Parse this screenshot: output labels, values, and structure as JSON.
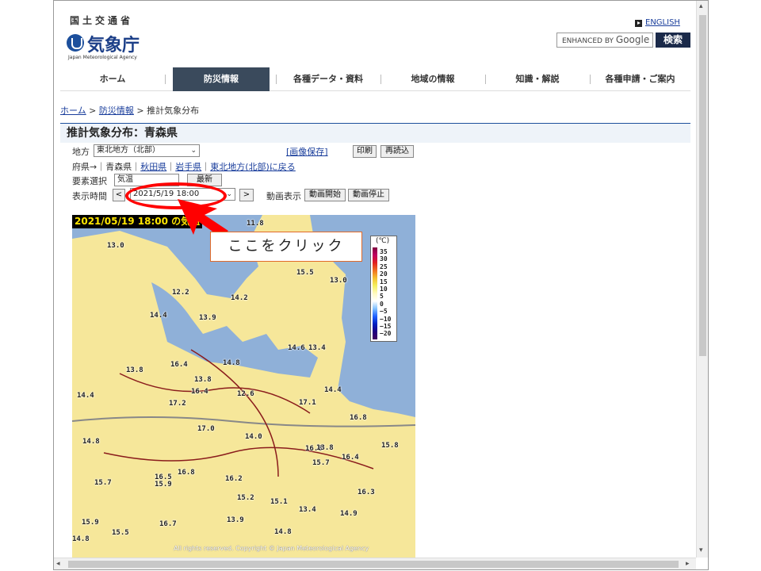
{
  "header": {
    "ministry": "国土交通省",
    "agency_name": "気象庁",
    "agency_en": "Japan Meteorological Agency",
    "english_link": "ENGLISH",
    "search_placeholder": "ENHANCED BY",
    "search_brand": "Google",
    "search_button": "検索"
  },
  "nav": [
    "ホーム",
    "防災情報",
    "各種データ・資料",
    "地域の情報",
    "知識・解説",
    "各種申請・ご案内"
  ],
  "breadcrumb": {
    "home": "ホーム",
    "sep": ">",
    "disaster": "防災情報",
    "current": "推計気象分布"
  },
  "page_title": "推計気象分布：青森県",
  "controls": {
    "region_label": "地方",
    "region_value": "東北地方（北部）",
    "save_image": "[画像保存]",
    "print": "印刷",
    "reload": "再読込",
    "pref_label": "府県→｜",
    "pref_current": "青森県",
    "pref_sep": "｜",
    "pref_akita": "秋田県",
    "pref_iwate": "岩手県",
    "pref_back": "東北地方(北部)に戻る",
    "element_label": "要素選択",
    "element_value": "気温",
    "latest": "最新",
    "time_label": "表示時間",
    "prev": "<",
    "time_value": "2021/5/19 18:00",
    "next": ">",
    "anim_label": "動画表示",
    "anim_start": "動画開始",
    "anim_stop": "動画停止"
  },
  "map": {
    "title": "2021/05/19 18:00 の気温",
    "copyright": "All rights reserved. Copyright © Japan Meteorological Agency",
    "labels": [
      "11.8",
      "13.0",
      "15.5",
      "13.0",
      "12.2",
      "14.2",
      "14.4",
      "13.9",
      "14.6",
      "13.4",
      "13.8",
      "16.4",
      "14.8",
      "13.8",
      "16.4",
      "12.6",
      "14.4",
      "14.4",
      "17.2",
      "17.1",
      "16.8",
      "17.0",
      "14.0",
      "14.8",
      "16.8",
      "15.8",
      "13.8",
      "15.7",
      "16.4",
      "16.5",
      "16.8",
      "15.9",
      "16.2",
      "15.7",
      "16.3",
      "15.2",
      "15.1",
      "13.4",
      "15.9",
      "16.7",
      "13.9",
      "14.9",
      "14.8",
      "15.5",
      "14.8"
    ]
  },
  "legend": {
    "unit": "(℃)",
    "ticks": [
      "35",
      "30",
      "25",
      "20",
      "15",
      "10",
      "5",
      "0",
      "−5",
      "−10",
      "−15",
      "−20"
    ]
  },
  "annotation": {
    "callout": "ここをクリック"
  }
}
